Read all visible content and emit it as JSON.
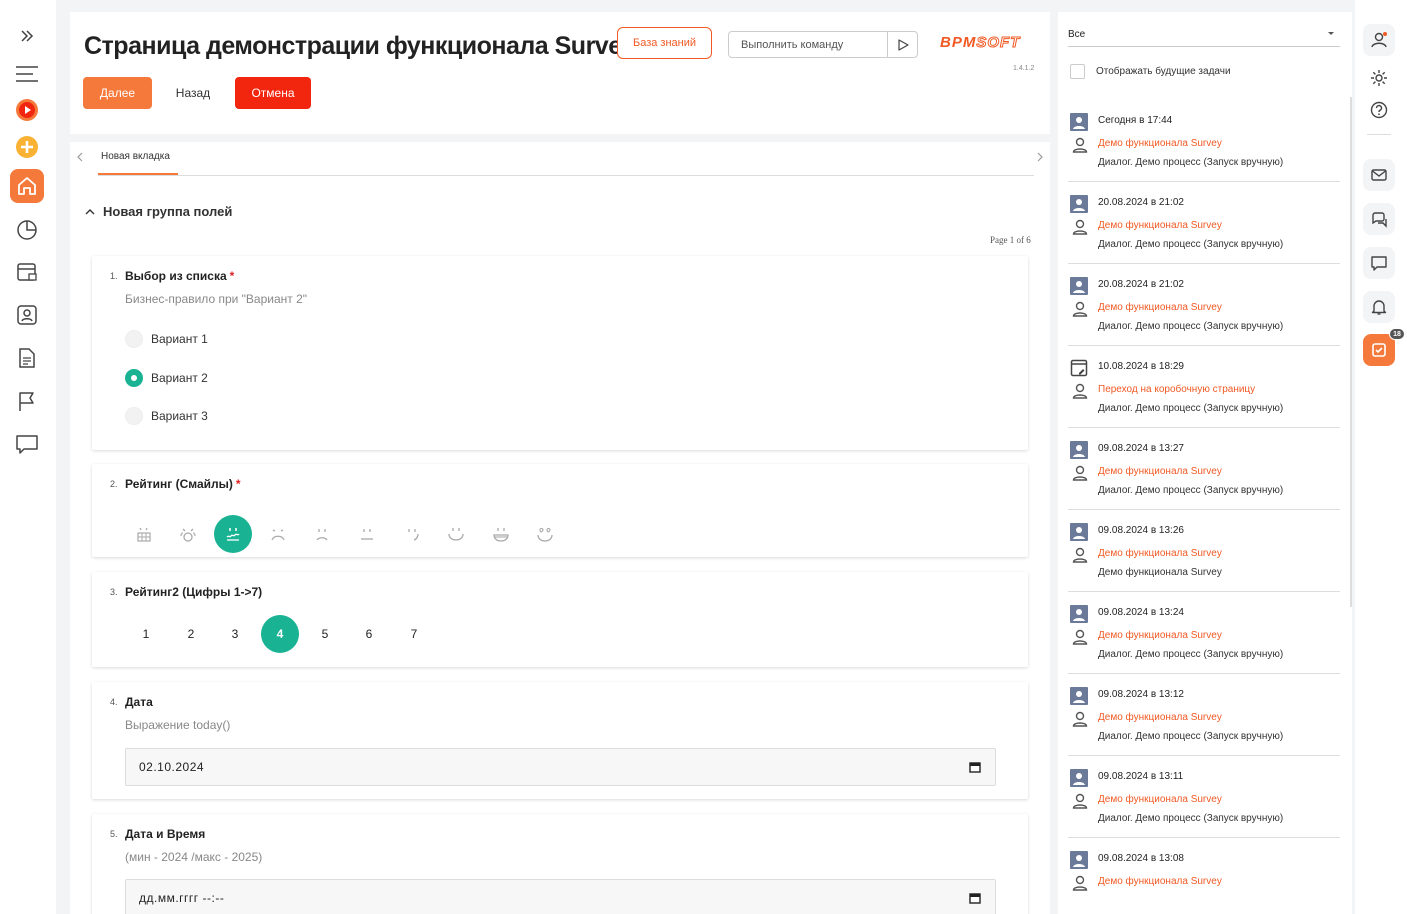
{
  "header": {
    "title": "Страница демонстрации функционала Survey",
    "knowledge_base_label": "База знаний",
    "command_placeholder": "Выполнить команду",
    "logo_brand": "BPM",
    "logo_soft": "SOFT",
    "version": "1.4.1.2"
  },
  "actions": {
    "next_label": "Далее",
    "back_label": "Назад",
    "cancel_label": "Отмена"
  },
  "tabs": [
    {
      "label": "Новая вкладка"
    }
  ],
  "group": {
    "title": "Новая группа полей"
  },
  "pager": "Page 1 of 6",
  "questions": {
    "q1": {
      "num": "1.",
      "title": "Выбор из списка",
      "required": "*",
      "description": "Бизнес-правило при \"Вариант 2\"",
      "options": [
        "Вариант 1",
        "Вариант 2",
        "Вариант 3"
      ],
      "selected_index": 1
    },
    "q2": {
      "num": "2.",
      "title": "Рейтинг (Смайлы)",
      "required": "*",
      "smileys": [
        "very-sad-icon",
        "sad-icon",
        "selected-smiley-icon",
        "frown-icon",
        "slight-frown-icon",
        "neutral-icon",
        "slight-smile-icon",
        "smile-icon",
        "grin-icon",
        "love-icon"
      ],
      "selected_index": 2
    },
    "q3": {
      "num": "3.",
      "title": "Рейтинг2 (Цифры 1->7)",
      "values": [
        "1",
        "2",
        "3",
        "4",
        "5",
        "6",
        "7"
      ],
      "selected": "4"
    },
    "q4": {
      "num": "4.",
      "title": "Дата",
      "description": "Выражение today()",
      "value": "02.10.2024"
    },
    "q5": {
      "num": "5.",
      "title": "Дата и Время",
      "description": "(мин - 2024 /макс - 2025)",
      "value": "дд.мм.гггг --:--"
    }
  },
  "tasks_panel": {
    "filter": "Все",
    "show_future_label": "Отображать будущие задачи",
    "items": [
      {
        "date": "Сегодня в 17:44",
        "link": "Демо функционала Survey",
        "sub": "Диалог. Демо процесс (Запуск вручную)",
        "icon": "user-card-icon"
      },
      {
        "date": "20.08.2024 в 21:02",
        "link": "Демо функционала Survey",
        "sub": "Диалог. Демо процесс (Запуск вручную)",
        "icon": "user-card-icon"
      },
      {
        "date": "20.08.2024 в 21:02",
        "link": "Демо функционала Survey",
        "sub": "Диалог. Демо процесс (Запуск вручную)",
        "icon": "user-card-icon"
      },
      {
        "date": "10.08.2024 в 18:29",
        "link": "Переход на коробочную страницу",
        "sub": "Диалог. Демо процесс (Запуск вручную)",
        "icon": "page-edit-icon"
      },
      {
        "date": "09.08.2024 в 13:27",
        "link": "Демо функционала Survey",
        "sub": "Диалог. Демо процесс (Запуск вручную)",
        "icon": "user-card-icon"
      },
      {
        "date": "09.08.2024 в 13:26",
        "link": "Демо функционала Survey",
        "sub": "Демо функционала Survey",
        "icon": "user-card-icon"
      },
      {
        "date": "09.08.2024 в 13:24",
        "link": "Демо функционала Survey",
        "sub": "Диалог. Демо процесс (Запуск вручную)",
        "icon": "user-card-icon"
      },
      {
        "date": "09.08.2024 в 13:12",
        "link": "Демо функционала Survey",
        "sub": "Диалог. Демо процесс (Запуск вручную)",
        "icon": "user-card-icon"
      },
      {
        "date": "09.08.2024 в 13:11",
        "link": "Демо функционала Survey",
        "sub": "Диалог. Демо процесс (Запуск вручную)",
        "icon": "user-card-icon"
      },
      {
        "date": "09.08.2024 в 13:08",
        "link": "Демо функционала Survey",
        "sub": "",
        "icon": "user-card-icon"
      }
    ]
  },
  "sidebar_right": {
    "tasks_badge": "18"
  },
  "colors": {
    "accent": "#f5793b",
    "danger": "#f2260f",
    "selection": "#19b394",
    "link": "#f15a24"
  }
}
